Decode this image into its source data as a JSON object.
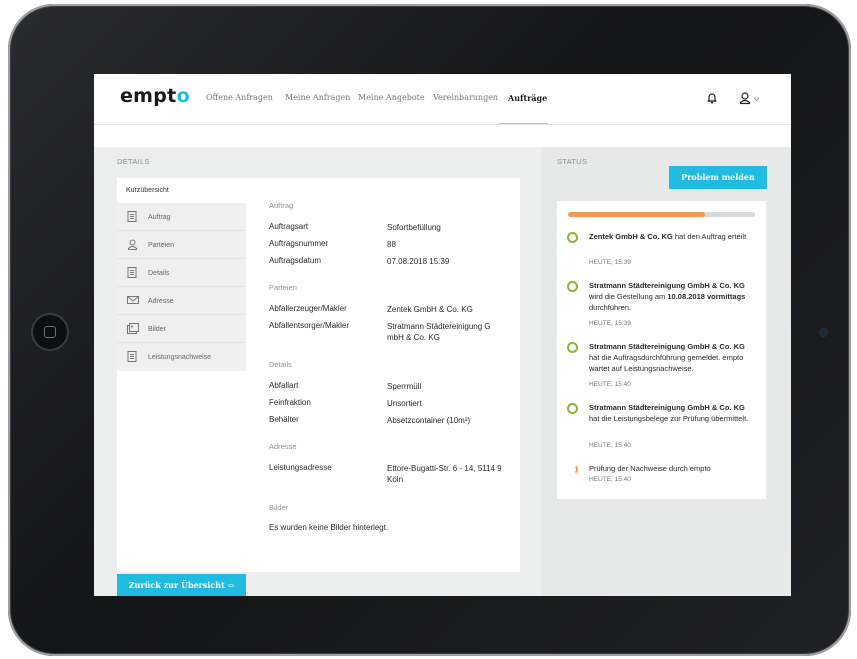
{
  "brand": {
    "logo_main": "empt",
    "logo_accent": "o"
  },
  "nav": {
    "items": [
      "Offene Anfragen",
      "Meine Anfragen",
      "Meine Angebote",
      "Vereinbarungen",
      "Aufträge"
    ],
    "active": "Aufträge"
  },
  "sections": {
    "details": "DETAILS",
    "status": "STATUS"
  },
  "sidebar": {
    "header": "Kurzübersicht",
    "items": [
      {
        "label": "Auftrag",
        "icon": "document-icon"
      },
      {
        "label": "Parteien",
        "icon": "user-icon"
      },
      {
        "label": "Details",
        "icon": "document-icon"
      },
      {
        "label": "Adresse",
        "icon": "envelope-icon"
      },
      {
        "label": "Bilder",
        "icon": "images-icon"
      },
      {
        "label": "Leistungsnachweise",
        "icon": "document-icon"
      }
    ]
  },
  "details": {
    "auftrag": {
      "title": "Auftrag",
      "rows": [
        {
          "label": "Auftragsart",
          "value": "Sofortbefüllung"
        },
        {
          "label": "Auftragsnummer",
          "value": "88"
        },
        {
          "label": "Auftragsdatum",
          "value": "07.08.2018 15:39"
        }
      ]
    },
    "parteien": {
      "title": "Parteien",
      "rows": [
        {
          "label": "Abfallerzeuger/Makler",
          "value": "Zentek GmbH & Co. KG"
        },
        {
          "label": "Abfallentsorger/Makler",
          "value": "Stratmann Städtereinigung G mbH & Co. KG"
        }
      ]
    },
    "details": {
      "title": "Details",
      "rows": [
        {
          "label": "Abfallart",
          "value": "Sperrmüll"
        },
        {
          "label": "Feinfraktion",
          "value": "Unsortiert"
        },
        {
          "label": "Behälter",
          "value": "Absetzcontainer (10m³)"
        }
      ]
    },
    "adresse": {
      "title": "Adresse",
      "rows": [
        {
          "label": "Leistungsadresse",
          "value": "Ettore-Bugatti-Str. 6 - 14, 5114 9 Köln"
        }
      ]
    },
    "bilder": {
      "title": "Bilder",
      "empty_text": "Es wurden keine Bilder hinterlegt."
    }
  },
  "buttons": {
    "back": "Zurück zur Übersicht ⇦",
    "problem": "Problem melden"
  },
  "status": {
    "progress": 0.73,
    "events": [
      {
        "bold": "Zentek GmbH & Co. KG",
        "text": " hat den Auftrag erteilt",
        "time": "HEUTE, 15:39",
        "state": "done"
      },
      {
        "bold": "Stratmann Städtereinigung GmbH & Co. KG",
        "text": " wird die Gestellung am ",
        "bold2": "10.08.2018 vormittags",
        "text2": " durchführen.",
        "time": "HEUTE, 15:39",
        "state": "done"
      },
      {
        "bold": "Stratmann Städtereinigung GmbH & Co. KG",
        "text": " hat die Auftragsdurchführung gemeldet. empto wartet auf Leistungsnachweise.",
        "time": "HEUTE, 15:40",
        "state": "done"
      },
      {
        "bold": "Stratmann Städtereinigung GmbH & Co. KG",
        "text": " hat die Leistungsbelege zur Prüfung übermittelt.",
        "time": "HEUTE, 15:40",
        "state": "done"
      },
      {
        "bold": "",
        "text": "Prüfung der Nachweise durch empto",
        "time": "HEUTE, 15:40",
        "state": "pending"
      }
    ]
  },
  "colors": {
    "accent": "#1fbbe0",
    "progress": "#f39a5b",
    "done": "#8ab53a"
  }
}
